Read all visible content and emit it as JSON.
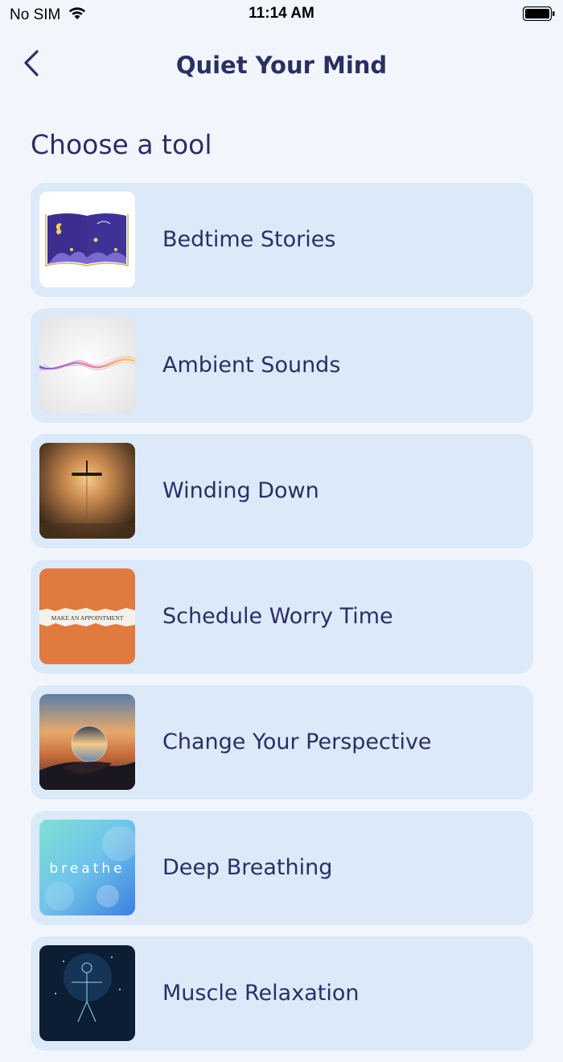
{
  "status": {
    "carrier": "No SIM",
    "time": "11:14 AM"
  },
  "nav": {
    "title": "Quiet Your Mind"
  },
  "section": {
    "title": "Choose a tool"
  },
  "tools": [
    {
      "label": "Bedtime Stories",
      "thumb": "book-illustration"
    },
    {
      "label": "Ambient Sounds",
      "thumb": "sound-wave-image"
    },
    {
      "label": "Winding Down",
      "thumb": "lamp-image"
    },
    {
      "label": "Schedule Worry Time",
      "thumb": "appointment-paper-image",
      "thumb_text": "MAKE AN APPOINTMENT"
    },
    {
      "label": "Change Your Perspective",
      "thumb": "crystal-ball-image"
    },
    {
      "label": "Deep Breathing",
      "thumb": "breathe-image",
      "thumb_text": "breathe"
    },
    {
      "label": "Muscle Relaxation",
      "thumb": "body-scan-image"
    }
  ],
  "colors": {
    "background": "#f2f6fc",
    "card": "#dce9f9",
    "text": "#2a2f63"
  }
}
